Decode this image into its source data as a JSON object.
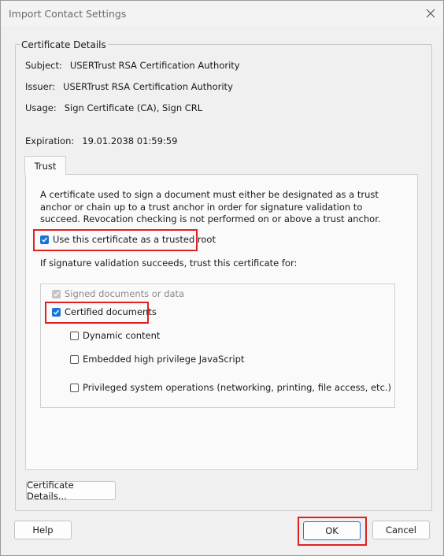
{
  "window": {
    "title": "Import Contact Settings"
  },
  "group": {
    "legend": "Certificate Details"
  },
  "fields": {
    "subject_label": "Subject:",
    "subject_value": "USERTrust RSA Certification Authority",
    "issuer_label": "Issuer:",
    "issuer_value": "USERTrust RSA Certification Authority",
    "usage_label": "Usage:",
    "usage_value": "Sign Certificate (CA), Sign CRL",
    "expiration_label": "Expiration:",
    "expiration_value": "19.01.2038 01:59:59"
  },
  "tabs": [
    {
      "label": "Trust"
    }
  ],
  "trust": {
    "description": "A certificate used to sign a document must either be designated as a trust anchor or chain up to a trust anchor in order for signature validation to succeed.  Revocation checking is not performed on or above a trust anchor.",
    "use_root_label": "Use this certificate as a trusted root",
    "use_root_checked": true,
    "trust_for_label": "If signature validation succeeds, trust this certificate for:",
    "options": {
      "signed_docs": {
        "label": "Signed documents or data",
        "checked": true,
        "disabled": true
      },
      "certified_docs": {
        "label": "Certified documents",
        "checked": true
      },
      "dynamic_content": {
        "label": "Dynamic content",
        "checked": false
      },
      "embedded_js": {
        "label": "Embedded high privilege JavaScript",
        "checked": false
      },
      "privileged_ops": {
        "label": "Privileged system operations (networking, printing, file access, etc.)",
        "checked": false
      }
    }
  },
  "buttons": {
    "cert_details": "Certificate Details...",
    "help": "Help",
    "ok": "OK",
    "cancel": "Cancel"
  },
  "colors": {
    "accent": "#1a73d9",
    "highlight": "#e02020"
  }
}
